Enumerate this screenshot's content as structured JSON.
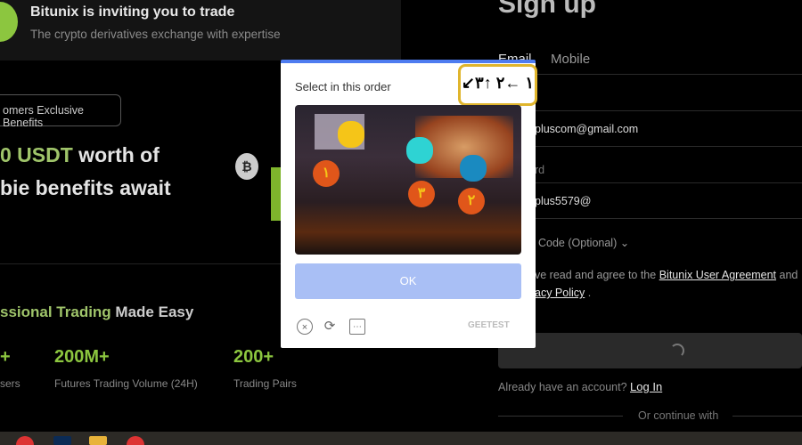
{
  "banner": {
    "title": "Bitunix is inviting you to trade",
    "subtitle": "The crypto derivatives exchange with expertise"
  },
  "promo": {
    "badge": "omers Exclusive Benefits",
    "headline_green": "0 USDT",
    "headline_rest": " worth of",
    "headline2": "bie benefits await",
    "coin_symbol": "₿",
    "tagline_green": "ssional Trading",
    "tagline_rest": " Made Easy"
  },
  "stats": [
    {
      "value": "+",
      "label": "sers"
    },
    {
      "value": "200M+",
      "label": "Futures Trading Volume (24H)"
    },
    {
      "value": "200+",
      "label": "Trading Pairs"
    }
  ],
  "signup": {
    "title": "Sign up",
    "tabs": [
      "Email",
      "Mobile"
    ],
    "email_value": "pluscom@gmail.com",
    "password_label": "rd",
    "password_value": "plus5579@",
    "referral_label": "Code (Optional) ⌄",
    "agree_pre": "ve read and agree to the",
    "agreement_link": "Bitunix User Agreement",
    "and": "and",
    "privacy_link": "acy Policy",
    "period": ".",
    "have_account": "Already have an account?",
    "login_link": "Log In",
    "or_continue": "Or continue with"
  },
  "captcha": {
    "title": "Select in this order",
    "hint": "↙١ ←٢ ↑٣",
    "markers": [
      "١",
      "٣",
      "٢"
    ],
    "ok_label": "OK",
    "brand": "GEETEST",
    "accent": "#4e7cf0",
    "hint_border": "#e0b52c"
  }
}
